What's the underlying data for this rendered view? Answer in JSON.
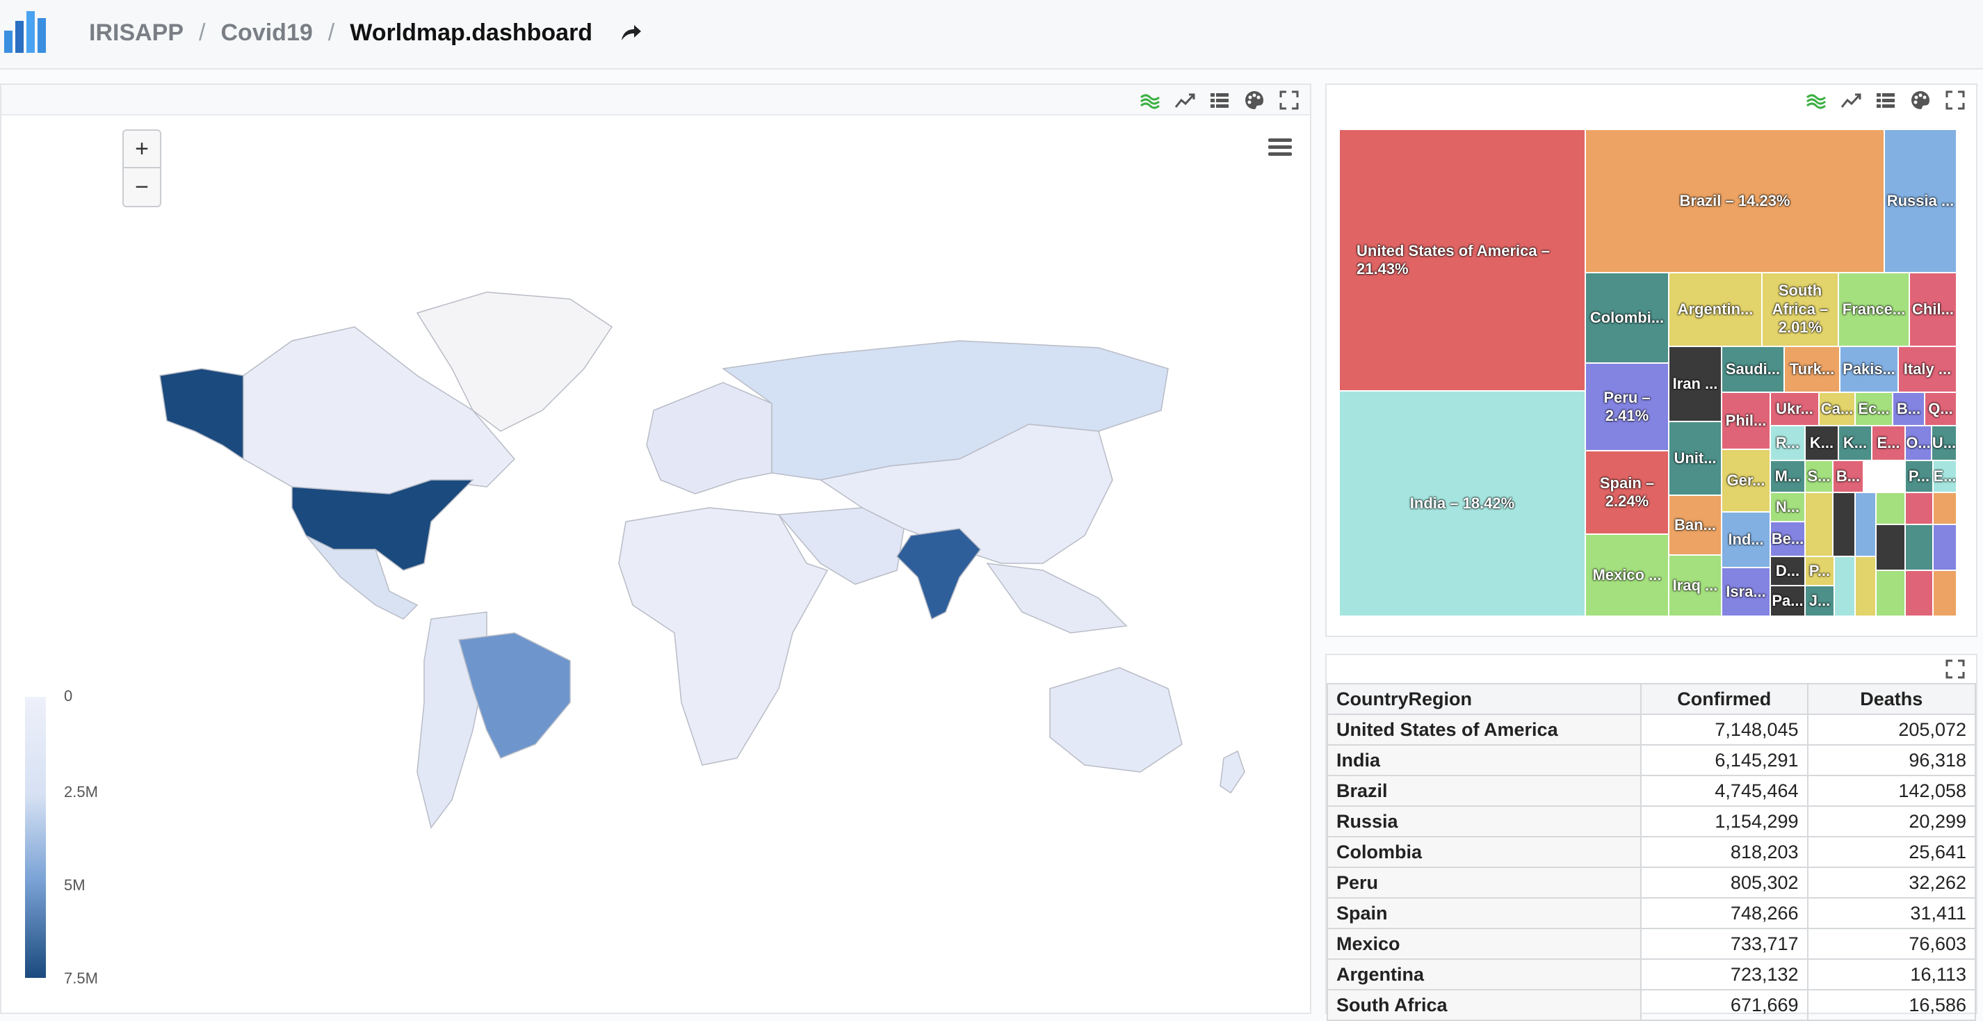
{
  "header": {
    "crumbs": [
      "IRISAPP",
      "Covid19",
      "Worldmap.dashboard"
    ],
    "logo_icon": "bar-chart-logo-icon",
    "share_icon": "share-arrow-icon"
  },
  "toolbar_icons": [
    "area-chart-icon",
    "line-chart-icon",
    "list-icon",
    "palette-icon",
    "fullscreen-icon"
  ],
  "map": {
    "zoom_in": "+",
    "zoom_out": "−",
    "legend_ticks": [
      "0",
      "2.5M",
      "5M",
      "7.5M"
    ],
    "colors": {
      "low": "#eef0fa",
      "mid": "#7ba3d6",
      "high": "#1b4a7e"
    }
  },
  "chart_data": {
    "type": "treemap",
    "labels": [
      "United States of America – 21.43%",
      "India – 18.42%",
      "Brazil – 14.23%",
      "Russia ...",
      "Colombi...",
      "Argentin...",
      "South Africa – 2.01%",
      "France...",
      "Chil...",
      "Peru – 2.41%",
      "Iran ...",
      "Saudi...",
      "Turk...",
      "Pakis...",
      "Italy ...",
      "Spain – 2.24%",
      "Phil...",
      "Ukr...",
      "Ca...",
      "Ec...",
      "B...",
      "Q...",
      "Unit...",
      "R...",
      "K...",
      "K...",
      "E...",
      "O...",
      "U...",
      "Ger...",
      "M...",
      "S...",
      "B...",
      "P...",
      "E...",
      "Ban...",
      "N...",
      "Mexico ...",
      "Ind...",
      "Be...",
      "Iraq ...",
      "Isra...",
      "D...",
      "P...",
      "Pa...",
      "J..."
    ]
  },
  "table": {
    "columns": [
      "CountryRegion",
      "Confirmed",
      "Deaths"
    ],
    "rows": [
      [
        "United States of America",
        "7,148,045",
        "205,072"
      ],
      [
        "India",
        "6,145,291",
        "96,318"
      ],
      [
        "Brazil",
        "4,745,464",
        "142,058"
      ],
      [
        "Russia",
        "1,154,299",
        "20,299"
      ],
      [
        "Colombia",
        "818,203",
        "25,641"
      ],
      [
        "Peru",
        "805,302",
        "32,262"
      ],
      [
        "Spain",
        "748,266",
        "31,411"
      ],
      [
        "Mexico",
        "733,717",
        "76,603"
      ],
      [
        "Argentina",
        "723,132",
        "16,113"
      ],
      [
        "South Africa",
        "671,669",
        "16,586"
      ]
    ]
  }
}
